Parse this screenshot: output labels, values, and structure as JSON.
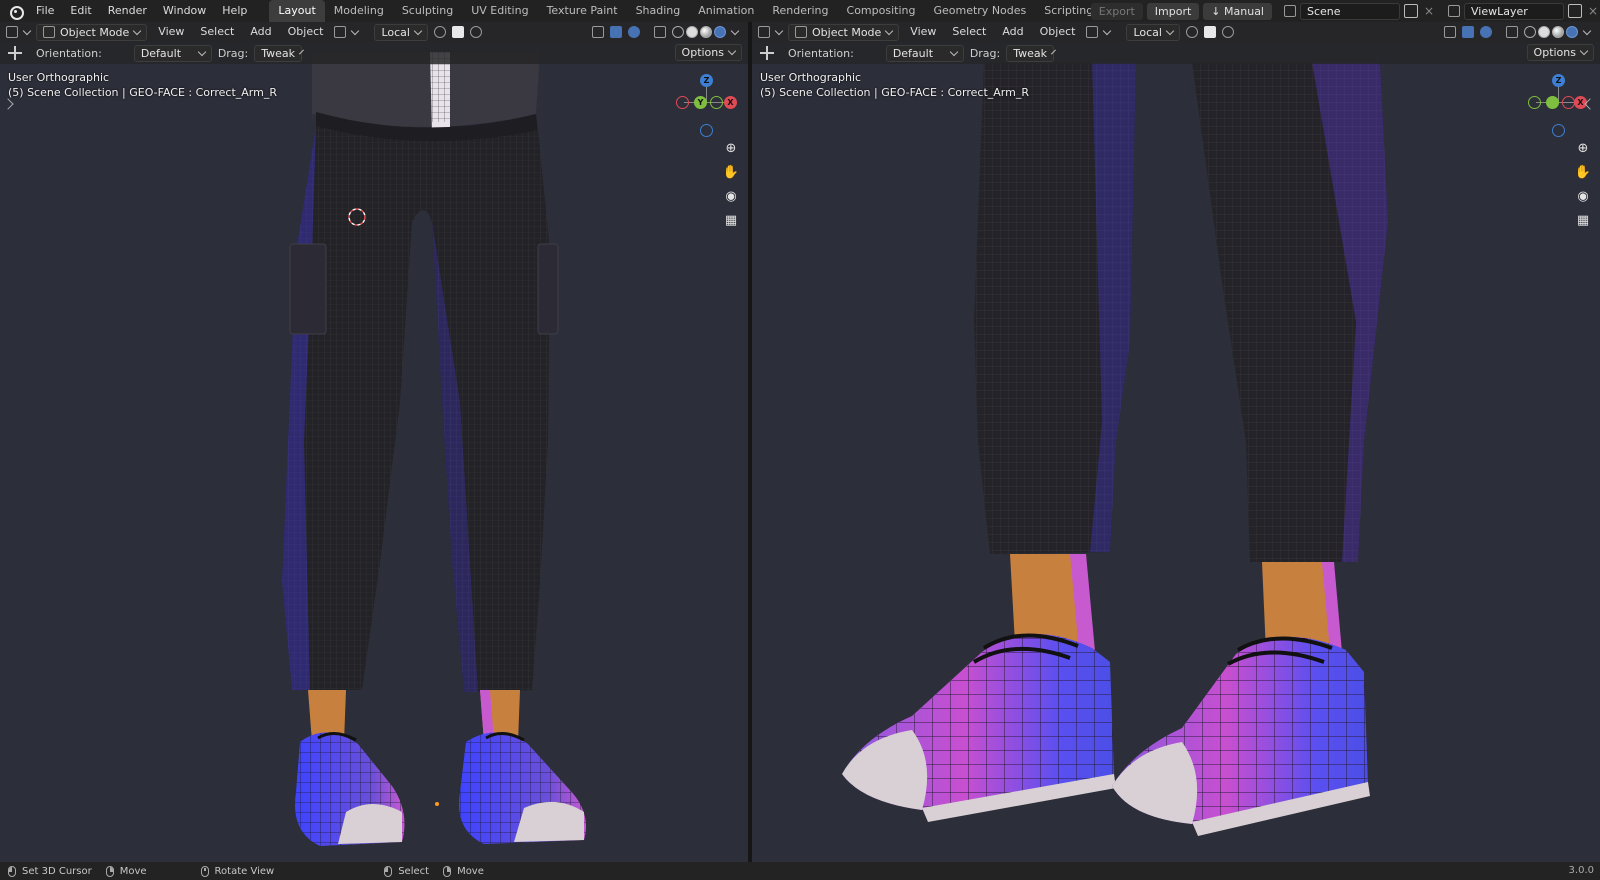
{
  "top_menu": [
    "File",
    "Edit",
    "Render",
    "Window",
    "Help"
  ],
  "workspace_tabs": [
    "Layout",
    "Modeling",
    "Sculpting",
    "UV Editing",
    "Texture Paint",
    "Shading",
    "Animation",
    "Rendering",
    "Compositing",
    "Geometry Nodes",
    "Scripting"
  ],
  "active_tab": "Layout",
  "top_right": {
    "export_label": "Export",
    "import_label": "Import",
    "manual_label": "Manual",
    "scene_name": "Scene",
    "view_layer": "ViewLayer"
  },
  "viewport_header": {
    "mode": "Object Mode",
    "menus": [
      "View",
      "Select",
      "Add",
      "Object"
    ],
    "transform": "Local"
  },
  "tool_header": {
    "orientation_label": "Orientation:",
    "orientation_value": "Default",
    "drag_label": "Drag:",
    "drag_value": "Tweak",
    "options_label": "Options"
  },
  "viewport_left": {
    "view_name": "User Orthographic",
    "collection_info": "(5) Scene Collection | GEO-FACE : Correct_Arm_R"
  },
  "viewport_right": {
    "view_name": "User Orthographic",
    "collection_info": "(5) Scene Collection | GEO-FACE : Correct_Arm_R"
  },
  "gizmo_axes": {
    "z": "Z",
    "y": "Y",
    "x": "X"
  },
  "colors": {
    "axis_x": "#e04a55",
    "axis_y": "#7fbf3f",
    "axis_z": "#3d7fd4",
    "pants": "#232226",
    "skin": "#c8803f",
    "shoe_magenta": "#c84fd0",
    "shoe_blue": "#4b4fe6",
    "sole": "#d8d0d4"
  },
  "status_bar": {
    "items": [
      "Set 3D Cursor",
      "Move",
      "Rotate View",
      "Select",
      "Move"
    ],
    "version": "3.0.0"
  }
}
